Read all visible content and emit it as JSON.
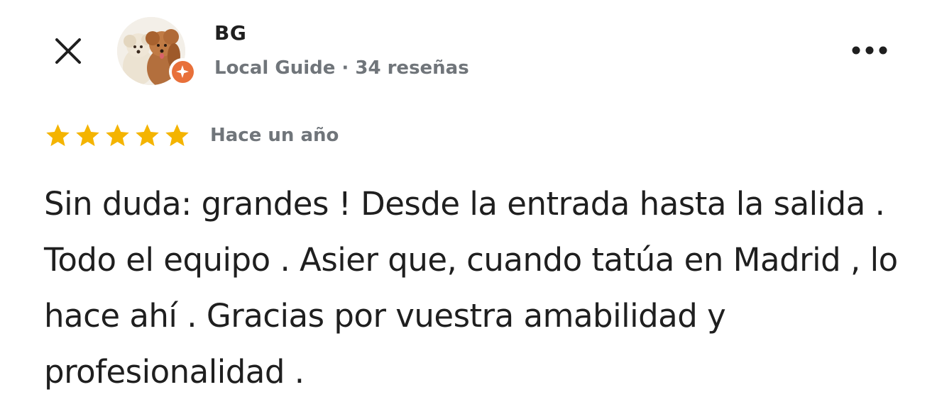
{
  "header": {
    "close_icon": "close-icon",
    "more_icon": "more-horizontal-icon"
  },
  "reviewer": {
    "name": "BG",
    "avatar_icon": "avatar-two-dogs",
    "badge_icon": "local-guide-badge-icon",
    "badge_color": "#e8703a",
    "level": "Local Guide",
    "separator": "·",
    "reviews_count": "34 reseñas"
  },
  "review": {
    "rating": 5,
    "rating_max": 5,
    "star_color": "#f4b400",
    "time_ago": "Hace un año",
    "text": "Sin duda: grandes ! Desde la entrada hasta la salida . Todo el equipo . Asier que, cuando tatúa en Madrid , lo hace ahí . Gracias por vuestra amabilidad y profesionalidad ."
  }
}
